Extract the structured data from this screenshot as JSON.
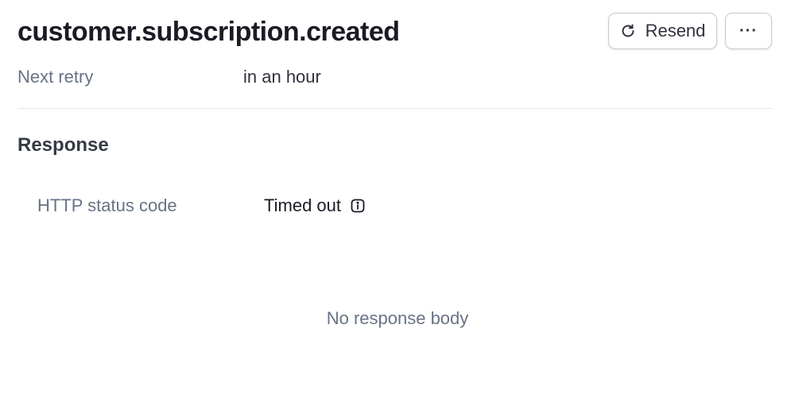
{
  "event": {
    "title": "customer.subscription.created"
  },
  "actions": {
    "resend_label": "Resend",
    "more_label": "···"
  },
  "retry": {
    "label": "Next retry",
    "value": "in an hour"
  },
  "response": {
    "heading": "Response",
    "status_label": "HTTP status code",
    "status_value": "Timed out",
    "empty_body": "No response body"
  },
  "icons": {
    "resend": "refresh-icon",
    "info": "info-icon"
  },
  "colors": {
    "text_primary": "#1a1b25",
    "text_secondary": "#687385",
    "border": "#c7cbd3",
    "divider": "#e3e5ea"
  }
}
